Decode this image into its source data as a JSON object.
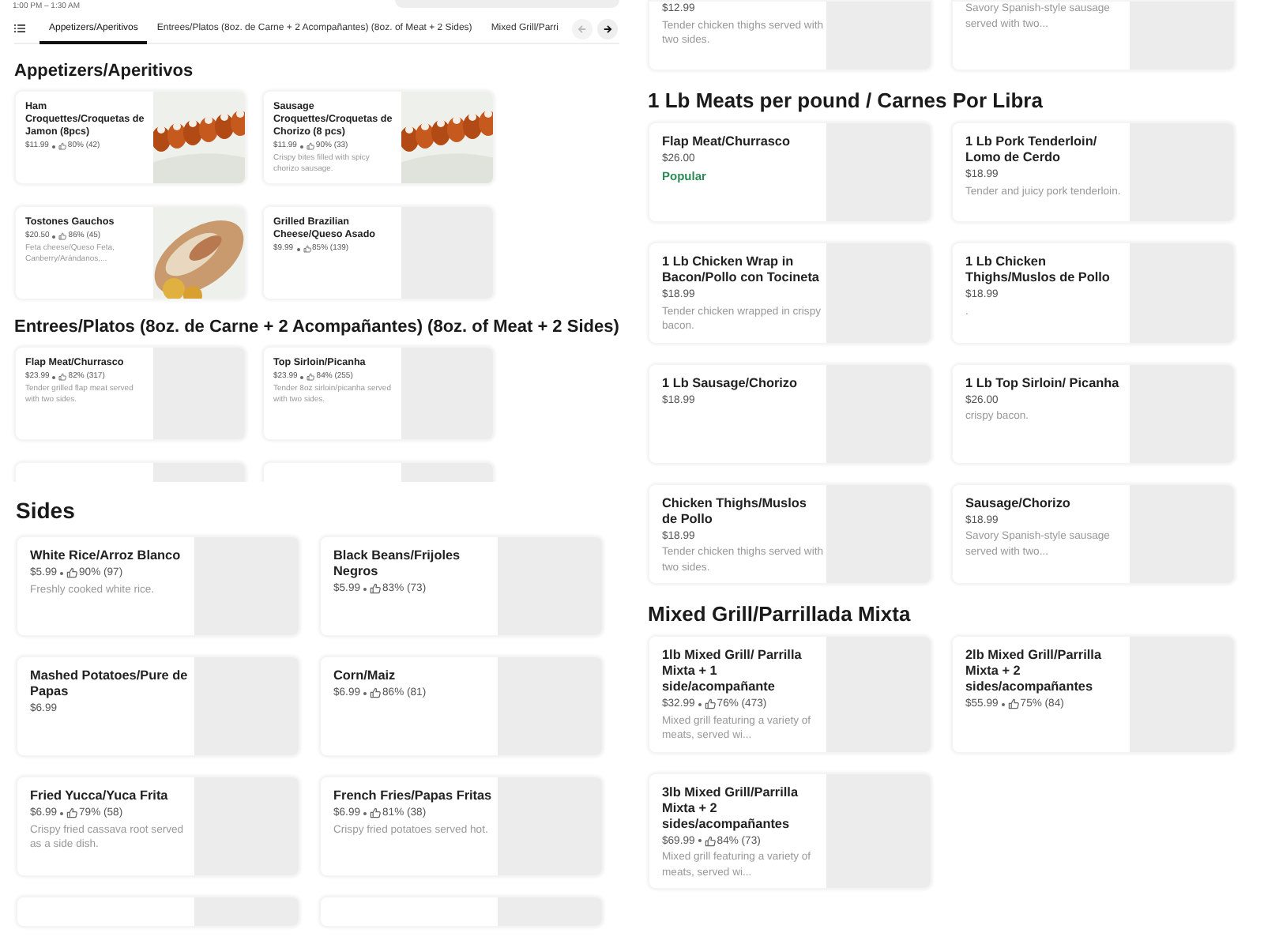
{
  "left_top": {
    "hours": "1:00 PM – 1:30 AM",
    "tabs": [
      {
        "label": "Appetizers/Aperitivos",
        "selected": true
      },
      {
        "label": "Entrees/Platos (8oz. de Carne + 2 Acompañantes) (8oz. of Meat + 2 Sides)",
        "selected": false
      },
      {
        "label": "Mixed Grill/Parri",
        "selected": false
      }
    ],
    "back_button": {
      "disabled": true
    },
    "forward_button": {
      "disabled": false
    },
    "sections": [
      {
        "title": "Appetizers/Aperitivos",
        "items": [
          {
            "kind": "card",
            "name": "Ham Croquettes/Croquetas de Jamon (8pcs)",
            "price": "$11.99",
            "rating": "80% (42)",
            "photo": true
          },
          {
            "kind": "card",
            "name": "Sausage Croquettes/Croquetas de Chorizo (8 pcs)",
            "price": "$11.99",
            "rating": "90% (33)",
            "description": "Crispy bites filled with spicy chorizo sausage.",
            "photo": true
          },
          {
            "kind": "card",
            "name": "Tostones Gauchos",
            "price": "$20.50",
            "rating": "86% (45)",
            "description": "Feta cheese/Queso Feta, Canberry/Arándanos,...",
            "photo": true
          },
          {
            "kind": "card",
            "name": "Grilled Brazilian Cheese/Queso Asado",
            "price": "$9.99",
            "rating": "85% (139)",
            "photo": false
          }
        ]
      },
      {
        "title": "Entrees/Platos (8oz. de Carne + 2 Acompañantes) (8oz. of Meat + 2 Sides)",
        "items": [
          {
            "kind": "card",
            "name": "Flap Meat/Churrasco",
            "price": "$23.99",
            "rating": "82% (317)",
            "description": "Tender grilled flap meat served with two sides.",
            "photo": false
          },
          {
            "kind": "card",
            "name": "Top Sirloin/Picanha",
            "price": "$23.99",
            "rating": "84% (255)",
            "description": "Tender 8oz sirloin/picanha served with two sides.",
            "photo": false
          },
          {
            "kind": "stub"
          },
          {
            "kind": "stub"
          }
        ]
      }
    ]
  },
  "left_bottom": {
    "sections": [
      {
        "title": "Sides",
        "items": [
          {
            "kind": "card",
            "name": "White Rice/Arroz Blanco",
            "price": "$5.99",
            "rating": "90% (97)",
            "description": "Freshly cooked white rice.",
            "photo": false
          },
          {
            "kind": "card",
            "name": "Black Beans/Frijoles Negros",
            "price": "$5.99",
            "rating": "83% (73)",
            "photo": false
          },
          {
            "kind": "card",
            "name": "Mashed Potatoes/Pure de Papas",
            "price": "$6.99",
            "photo": false
          },
          {
            "kind": "card",
            "name": "Corn/Maiz",
            "price": "$6.99",
            "rating": "86% (81)",
            "photo": false
          },
          {
            "kind": "card",
            "name": "Fried Yucca/Yuca Frita",
            "price": "$6.99",
            "rating": "79% (58)",
            "description": "Crispy fried cassava root served as a side dish.",
            "photo": false
          },
          {
            "kind": "card",
            "name": "French Fries/Papas Fritas",
            "price": "$6.99",
            "rating": "81% (38)",
            "description": "Crispy fried potatoes served hot.",
            "photo": false
          },
          {
            "kind": "stub"
          },
          {
            "kind": "stub"
          }
        ]
      }
    ]
  },
  "right": {
    "top_items": [
      {
        "kind": "partial",
        "price": "$12.99",
        "description": "Tender chicken thighs served with two sides."
      },
      {
        "kind": "partial",
        "description": "Savory Spanish-style sausage served with two..."
      }
    ],
    "sections": [
      {
        "title": "1 Lb Meats per pound / Carnes Por Libra",
        "items": [
          {
            "kind": "card",
            "name": "Flap Meat/Churrasco",
            "price": "$26.00",
            "badge": "Popular",
            "photo": false
          },
          {
            "kind": "card",
            "name": "1 Lb Pork Tenderloin/ Lomo de Cerdo",
            "price": "$18.99",
            "description": "Tender and juicy pork tenderloin.",
            "photo": false
          },
          {
            "kind": "card",
            "name": "1 Lb Chicken Wrap in Bacon/Pollo con Tocineta",
            "price": "$18.99",
            "description": "Tender chicken wrapped in crispy bacon.",
            "photo": false
          },
          {
            "kind": "card",
            "name": "1 Lb Chicken Thighs/Muslos de Pollo",
            "price": "$18.99",
            "description": ".",
            "photo": false
          },
          {
            "kind": "card",
            "name": "1 Lb Sausage/Chorizo",
            "price": "$18.99",
            "photo": false
          },
          {
            "kind": "card",
            "name": "1 Lb Top Sirloin/ Picanha",
            "price": "$26.00",
            "description": "crispy bacon.",
            "photo": false
          },
          {
            "kind": "card",
            "name": "Chicken Thighs/Muslos de Pollo",
            "price": "$18.99",
            "description": "Tender chicken thighs served with two sides.",
            "photo": false
          },
          {
            "kind": "card",
            "name": "Sausage/Chorizo",
            "price": "$18.99",
            "description": "Savory Spanish-style sausage served with two...",
            "photo": false
          }
        ]
      },
      {
        "title": "Mixed Grill/Parrillada Mixta",
        "items": [
          {
            "kind": "card",
            "name": "1lb Mixed Grill/ Parrilla Mixta + 1 side/acompañante",
            "price": "$32.99",
            "rating": "76% (473)",
            "description": "Mixed grill featuring a variety of meats, served wi...",
            "photo": false
          },
          {
            "kind": "card",
            "name": "2lb Mixed Grill/Parrilla Mixta + 2 sides/acompañantes",
            "price": "$55.99",
            "rating": "75% (84)",
            "photo": false
          },
          {
            "kind": "card",
            "name": "3lb Mixed Grill/Parrilla Mixta + 2 sides/acompañantes",
            "price": "$69.99",
            "rating": "84% (73)",
            "description": "Mixed grill featuring a variety of meats, served wi...",
            "photo": false
          }
        ]
      }
    ]
  }
}
